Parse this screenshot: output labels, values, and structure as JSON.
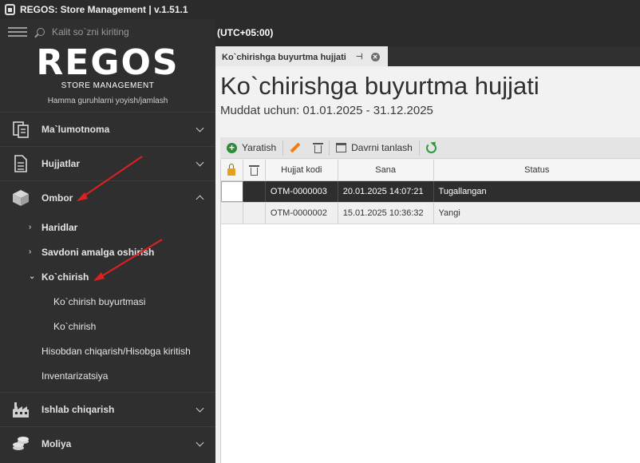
{
  "window": {
    "title": "REGOS: Store Management | v.1.51.1"
  },
  "search": {
    "placeholder": "Kalit so`zni kiriting"
  },
  "logo": {
    "text": "REGOS",
    "subtitle": "STORE MANAGEMENT",
    "note": "Hamma guruhlarni yoyish/jamlash"
  },
  "sidebar": {
    "main": [
      {
        "label": "Ma`lumotnoma",
        "icon": "reference-icon",
        "expanded": false
      },
      {
        "label": "Hujjatlar",
        "icon": "document-icon",
        "expanded": false
      },
      {
        "label": "Ombor",
        "icon": "box-icon",
        "expanded": true
      },
      {
        "label": "Ishlab chiqarish",
        "icon": "factory-icon",
        "expanded": false
      },
      {
        "label": "Moliya",
        "icon": "coins-icon",
        "expanded": false
      }
    ],
    "ombor_items": [
      {
        "label": "Haridlar"
      },
      {
        "label": "Savdoni amalga oshirish"
      },
      {
        "label": "Ko`chirish"
      }
    ],
    "kochirish_items": [
      {
        "label": "Ko`chirish buyurtmasi"
      },
      {
        "label": "Ko`chirish"
      }
    ],
    "ombor_extra": [
      {
        "label": "Hisobdan chiqarish/Hisobga kiritish"
      },
      {
        "label": "Inventarizatsiya"
      }
    ]
  },
  "header": {
    "timezone": "(UTC+05:00)"
  },
  "tab": {
    "label": "Ko`chirishga buyurtma hujjati"
  },
  "document": {
    "title": "Ko`chirishga buyurtma hujjati",
    "period": "Muddat uchun: 01.01.2025 - 31.12.2025"
  },
  "toolbar": {
    "create_label": "Yaratish",
    "period_label": "Davrni tanlash"
  },
  "table": {
    "columns": [
      "Hujjat kodi",
      "Sana",
      "Status"
    ],
    "rows": [
      {
        "code": "OTM-0000003",
        "date": "20.01.2025 14:07:21",
        "status": "Tugallangan"
      },
      {
        "code": "OTM-0000002",
        "date": "15.01.2025 10:36:32",
        "status": "Yangi"
      }
    ]
  },
  "colors": {
    "accent_green": "#2e8b3a",
    "selected_row": "#2e2e2e",
    "annotation_arrow": "#e02020"
  }
}
